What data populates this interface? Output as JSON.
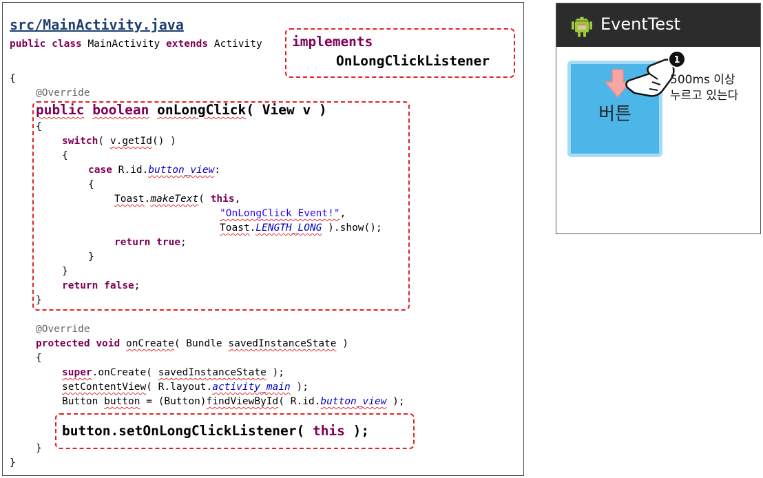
{
  "code": {
    "file_path": "src/MainActivity.java",
    "l1_kw1": "public",
    "l1_kw2": "class",
    "l1_name": "MainActivity",
    "l1_kw3": "extends",
    "l1_parent": "Activity",
    "impl_kw": "implements",
    "impl_iface": "OnLongClickListener",
    "open_brace": "{",
    "override1": "@Override",
    "sig_kw1": "public",
    "sig_kw2": "boolean",
    "sig_method": "onLongClick",
    "sig_params": "( View v )",
    "brace_open_m": "{",
    "switch_kw": "switch",
    "switch_expr_pre": "( ",
    "switch_expr": "v.getId",
    "switch_expr_post": "() )",
    "brace_sw": "{",
    "case_kw": "case",
    "case_pre": " R.id.",
    "case_field": "button_view",
    "case_colon": ":",
    "brace_case": "{",
    "toast_obj": "Toast",
    "toast_dot": ".",
    "toast_method": "makeText",
    "toast_paren": "( ",
    "toast_this": "this",
    "toast_comma": ",",
    "toast_str": "\"OnLongClick Event!\"",
    "toast_comma2": ",",
    "toast_len_obj": "Toast",
    "toast_len_dot": ".",
    "toast_len_field": "LENGTH_LONG",
    "toast_show": " ).show();",
    "ret_kw": "return",
    "ret_true": "true",
    "semi": ";",
    "brace_case_close": "}",
    "brace_sw_close": "}",
    "ret2_kw": "return",
    "ret_false": "false",
    "semi2": ";",
    "brace_m_close": "}",
    "override2": "@Override",
    "oc_kw1": "protected",
    "oc_kw2": "void",
    "oc_method": "onCreate",
    "oc_params_pre": "( Bundle ",
    "oc_param": "savedInstanceState",
    "oc_params_post": " )",
    "brace_oc": "{",
    "super_kw": "super",
    "super_call": ".onCreate",
    "super_args_pre": "( ",
    "super_arg": "savedInstanceState",
    "super_args_post": " );",
    "scv_method": "setContentView",
    "scv_pre": "( R.layout.",
    "scv_field": "activity_main",
    "scv_post": " );",
    "btn_decl_type": "Button ",
    "btn_decl_var": "button",
    "btn_decl_mid": " = (Button)",
    "btn_decl_call": "findViewById",
    "btn_decl_args": "( R.id.",
    "btn_decl_field": "button_view",
    "btn_decl_end": " );",
    "set_call_pre": "button.setOnLongClickListener( ",
    "set_call_this": "this",
    "set_call_post": " );",
    "brace_oc_close": "}",
    "brace_class_close": "}"
  },
  "phone": {
    "app_title": "EventTest",
    "button_label": "버튼",
    "step_number": "1",
    "note_line1": "500ms 이상",
    "note_line2": "누르고 있는다",
    "colors": {
      "titlebar": "#2c2c2c",
      "button": "#4db6e8",
      "highlight": "#e32020"
    }
  }
}
